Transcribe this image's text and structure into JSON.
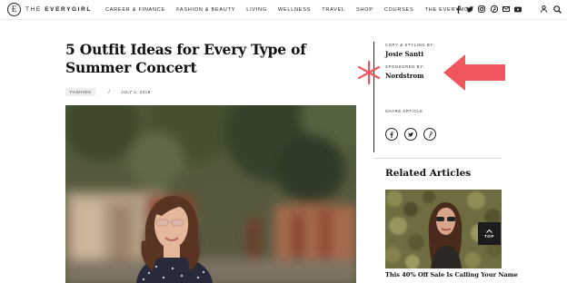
{
  "header": {
    "logo_mark": "E",
    "logo_text_light": "THE ",
    "logo_text_bold": "EVERYGIRL",
    "nav": [
      {
        "label": "CAREER & FINANCE"
      },
      {
        "label": "FASHION & BEAUTY"
      },
      {
        "label": "LIVING"
      },
      {
        "label": "WELLNESS"
      },
      {
        "label": "TRAVEL"
      },
      {
        "label": "SHOP"
      },
      {
        "label": "COURSES"
      },
      {
        "label": "THE EVERYMOM"
      }
    ],
    "social_icons": [
      "facebook-icon",
      "twitter-icon",
      "instagram-icon",
      "pinterest-icon",
      "email-icon",
      "youtube-icon"
    ],
    "right_icons": [
      "user-icon",
      "search-icon"
    ]
  },
  "article": {
    "title": "5 Outfit Ideas for Every Type of Summer Concert",
    "category": "FASHION",
    "separator": "/",
    "date": "JULY 2, 2018"
  },
  "sidebar": {
    "copy_label": "COPY & STYLING BY:",
    "copy_name": "Josie Santi",
    "sponsor_label": "SPONSORED BY:",
    "sponsor_name": "Nordstrom",
    "share_label": "SHARE ARTICLE",
    "share_icons": [
      "facebook-icon",
      "twitter-icon",
      "pinterest-icon"
    ],
    "related_title": "Related Articles",
    "related_caption": "This 40% Off Sale Is Calling Your Name",
    "top_label": "TOP"
  },
  "annotation": {
    "color": "#f0575c"
  }
}
